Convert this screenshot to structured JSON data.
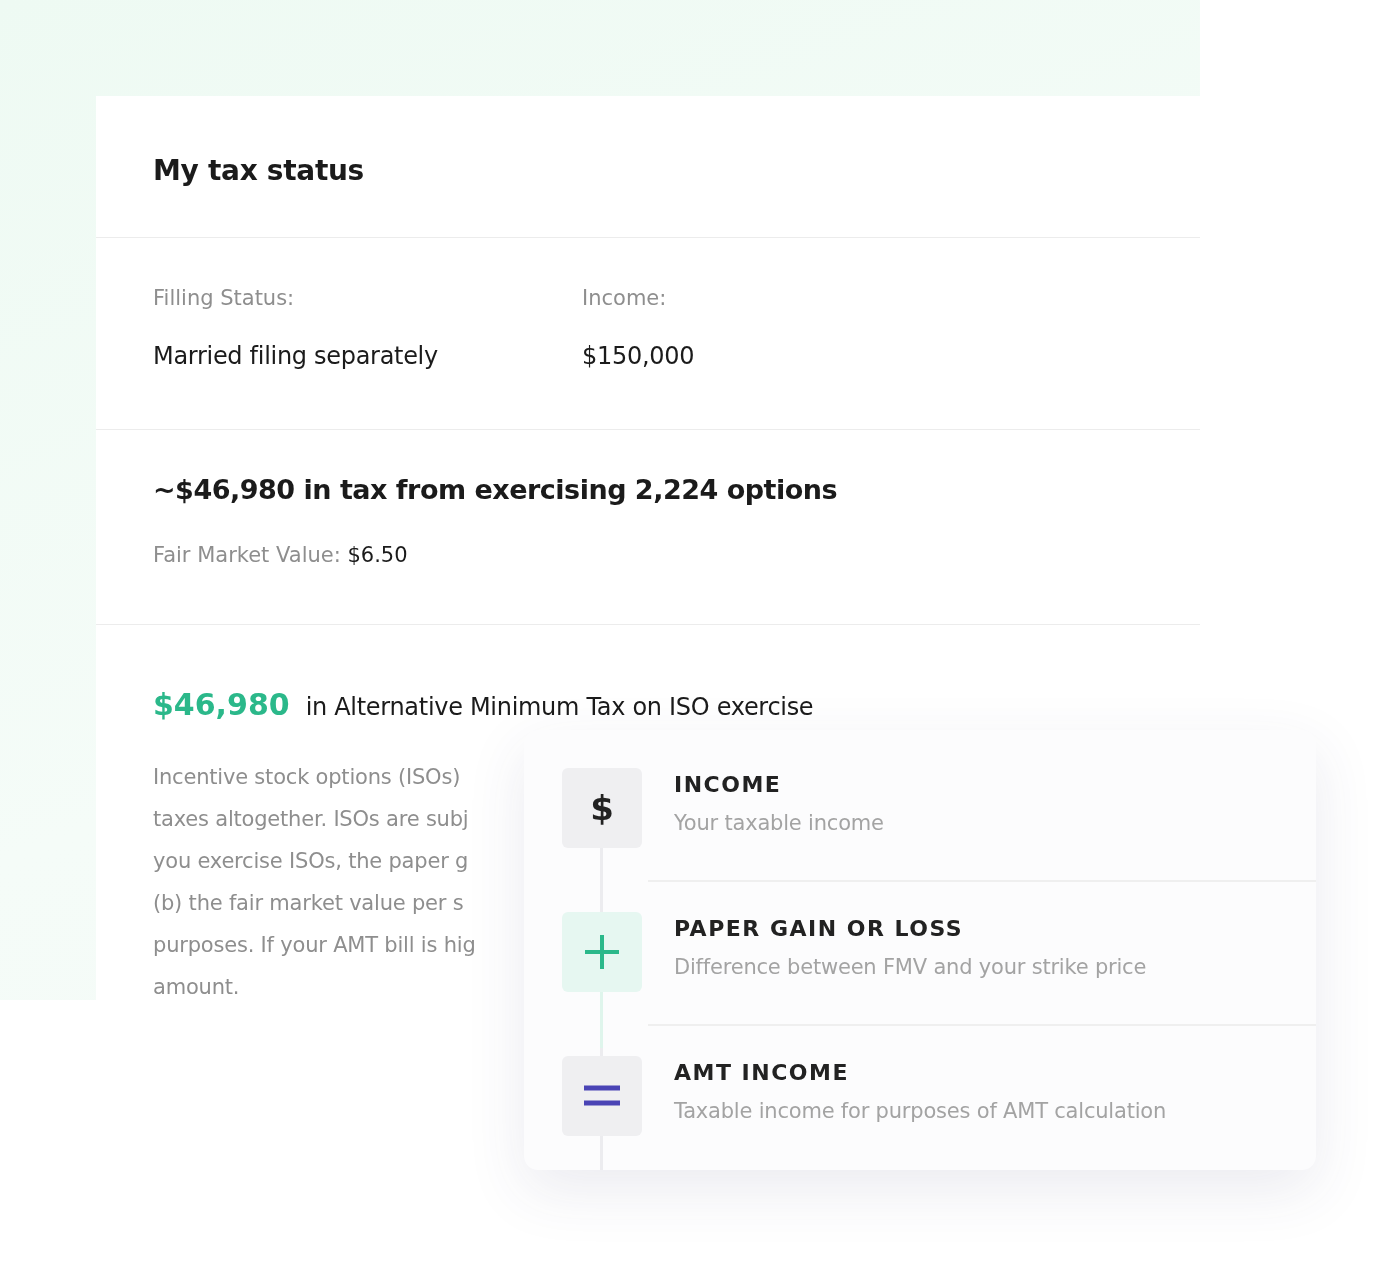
{
  "card": {
    "title": "My tax status",
    "fields": [
      {
        "label": "Filling Status:",
        "value": "Married filing separately"
      },
      {
        "label": "Income:",
        "value": "$150,000"
      }
    ],
    "summary": {
      "headline": "~$46,980 in tax from exercising 2,224 options",
      "fmv_label": "Fair Market Value:",
      "fmv_value": "$6.50"
    },
    "amt": {
      "amount": "$46,980",
      "text": "in Alternative Minimum Tax on ISO exercise",
      "paragraph_lines": [
        "Incentive stock options (ISOs)",
        "taxes altogether. ISOs are subj",
        "you exercise ISOs, the paper g",
        "(b) the fair market value per s",
        "purposes. If your AMT bill is hig",
        "amount."
      ]
    }
  },
  "steps": [
    {
      "kind": "dollar",
      "symbol": "$",
      "title": "INCOME",
      "description": "Your taxable income"
    },
    {
      "kind": "plus",
      "title": "PAPER GAIN OR LOSS",
      "description": "Difference between FMV and your strike price"
    },
    {
      "kind": "equals",
      "title": "AMT INCOME",
      "description": "Taxable income for purposes of AMT calculation"
    }
  ]
}
